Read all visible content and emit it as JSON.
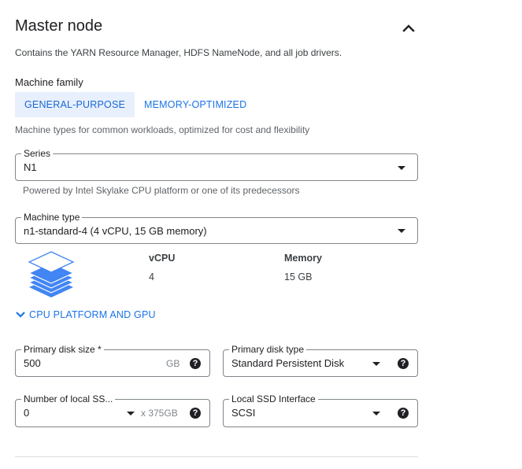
{
  "section": {
    "title": "Master node",
    "description": "Contains the YARN Resource Manager, HDFS NameNode, and all job drivers."
  },
  "machine_family": {
    "label": "Machine family",
    "tabs": [
      {
        "label": "GENERAL-PURPOSE",
        "active": true
      },
      {
        "label": "MEMORY-OPTIMIZED",
        "active": false
      }
    ],
    "hint": "Machine types for common workloads, optimized for cost and flexibility"
  },
  "series": {
    "label": "Series",
    "value": "N1",
    "hint": "Powered by Intel Skylake CPU platform or one of its predecessors"
  },
  "machine_type": {
    "label": "Machine type",
    "value": "n1-standard-4 (4 vCPU, 15 GB memory)",
    "vcpu_label": "vCPU",
    "vcpu_value": "4",
    "memory_label": "Memory",
    "memory_value": "15 GB",
    "icon": "stacked-layers-icon"
  },
  "cpu_platform": {
    "label": "CPU PLATFORM AND GPU"
  },
  "primary_disk_size": {
    "label": "Primary disk size *",
    "value": "500",
    "unit": "GB"
  },
  "primary_disk_type": {
    "label": "Primary disk type",
    "value": "Standard Persistent Disk"
  },
  "local_ssds": {
    "label": "Number of local SS...",
    "value": "0",
    "unit": "x 375GB"
  },
  "local_ssd_interface": {
    "label": "Local SSD Interface",
    "value": "SCSI"
  },
  "colors": {
    "accent": "#1a73e8",
    "tab_active_bg": "#e8f0fe",
    "border": "#80868b",
    "icon_blue": "#4285f4"
  }
}
